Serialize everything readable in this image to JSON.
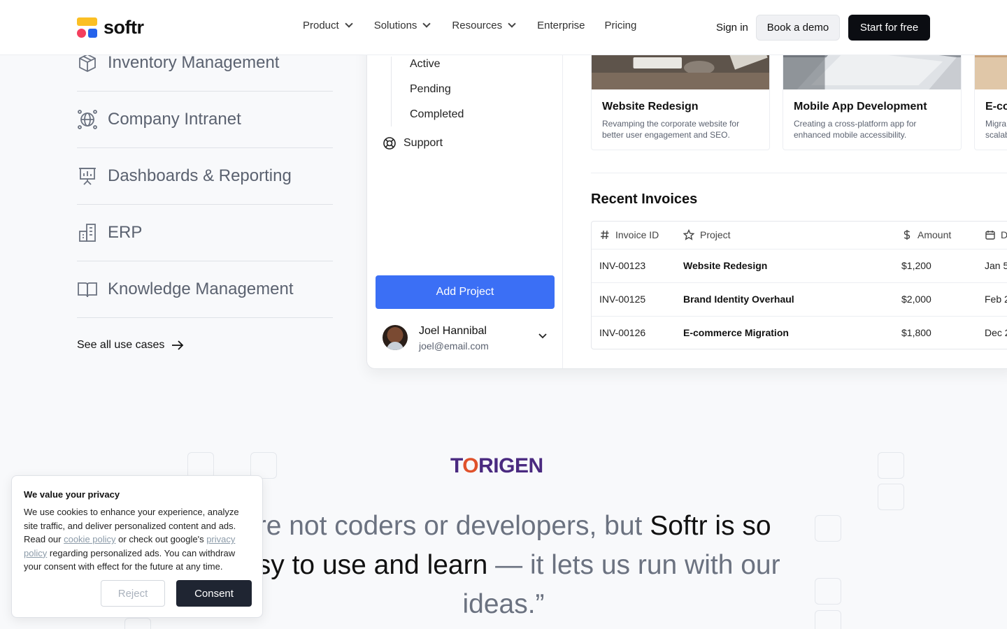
{
  "header": {
    "logo_text": "softr",
    "nav": [
      {
        "label": "Product"
      },
      {
        "label": "Solutions"
      },
      {
        "label": "Resources"
      },
      {
        "label": "Enterprise"
      },
      {
        "label": "Pricing"
      }
    ],
    "sign_in": "Sign in",
    "book_demo": "Book a demo",
    "start_free": "Start for free"
  },
  "usecases": {
    "items": [
      {
        "label": "Inventory Management",
        "icon": "box-icon"
      },
      {
        "label": "Company Intranet",
        "icon": "globe-network-icon"
      },
      {
        "label": "Dashboards & Reporting",
        "icon": "presentation-chart-icon"
      },
      {
        "label": "ERP",
        "icon": "buildings-icon"
      },
      {
        "label": "Knowledge Management",
        "icon": "book-open-icon"
      }
    ],
    "see_all": "See all use cases"
  },
  "mockup": {
    "sidebar": {
      "sub_items": [
        "Active",
        "Pending",
        "Completed"
      ],
      "support": "Support",
      "add_project": "Add Project",
      "user_name": "Joel Hannibal",
      "user_email": "joel@email.com"
    },
    "cards": [
      {
        "title": "Website Redesign",
        "desc": "Revamping the corporate website for better user engagement and SEO."
      },
      {
        "title": "Mobile App Development",
        "desc": "Creating a cross-platform app for enhanced mobile accessibility."
      },
      {
        "title": "E-co",
        "desc": "Migra scalab"
      }
    ],
    "invoices": {
      "title": "Recent Invoices",
      "columns": [
        "Invoice ID",
        "Project",
        "Amount",
        "D"
      ],
      "rows": [
        {
          "id": "INV-00123",
          "project": "Website Redesign",
          "amount": "$1,200",
          "date": "Jan 5"
        },
        {
          "id": "INV-00125",
          "project": "Brand Identity Overhaul",
          "amount": "$2,000",
          "date": "Feb 2"
        },
        {
          "id": "INV-00126",
          "project": "E-commerce Migration",
          "amount": "$1,800",
          "date": "Dec 2"
        }
      ]
    }
  },
  "testimonial": {
    "brand_a": "T",
    "brand_o": "O",
    "brand_b": "RIGEN",
    "quote_part1": "e’re not coders or developers, but ",
    "quote_hl1": "Softr is so easy to use and learn",
    "quote_part2": " — it lets us run with our ideas.”"
  },
  "cookie": {
    "title": "We value your privacy",
    "text_1": "We use cookies to enhance your experience, analyze site traffic, and deliver personalized content and ads. Read our ",
    "link_cookie": "cookie policy",
    "text_2": " or check out google's ",
    "link_privacy": "privacy policy",
    "text_3": " regarding personalized ads. You can withdraw your consent with effect for the future at any time.",
    "reject": "Reject",
    "consent": "Consent"
  }
}
